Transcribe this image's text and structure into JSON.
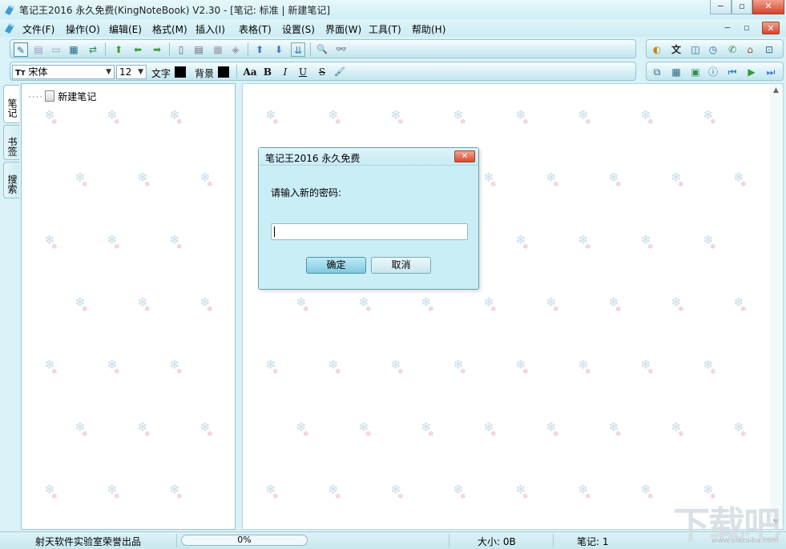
{
  "window": {
    "title": "笔记王2016 永久免费(KingNoteBook) V2.30 - [笔记: 标准 | 新建笔记]",
    "controls": {
      "minimize": "−",
      "restore": "▫",
      "close": "✕"
    }
  },
  "menubar": {
    "items": [
      {
        "label": "文件(F)"
      },
      {
        "label": "操作(O)"
      },
      {
        "label": "编辑(E)"
      },
      {
        "label": "格式(M)"
      },
      {
        "label": "插入(I)"
      },
      {
        "label": "表格(T)"
      },
      {
        "label": "设置(S)"
      },
      {
        "label": "界面(W)"
      },
      {
        "label": "工具(T)"
      },
      {
        "label": "帮助(H)"
      }
    ],
    "mdi_controls": {
      "minimize": "−",
      "restore": "▫",
      "close": "✕"
    }
  },
  "toolbar1": {
    "icons": [
      "✎",
      "▤",
      "▭",
      "▦",
      "⇄",
      "⬆",
      "⬅",
      "➡",
      "▯",
      "▤",
      "▦",
      "◈",
      "⬆",
      "⬇",
      "⇊",
      "🔍",
      "👓"
    ]
  },
  "toolbar_right1": {
    "icons": [
      "◐",
      "文",
      "◫",
      "◷",
      "✆",
      "⌂",
      "⊡"
    ]
  },
  "format_toolbar": {
    "font_name": "宋体",
    "font_size": "12",
    "text_color_label": "文字",
    "bg_color_label": "背景",
    "text_color": "#000000",
    "bg_color": "#000000",
    "aa_label": "Aa",
    "bold_label": "B",
    "italic_label": "I",
    "underline_label": "U",
    "strike_label": "S",
    "brush_icon": "🖌"
  },
  "toolbar_right2": {
    "icons": [
      "⧉",
      "▦",
      "▣",
      "ⓘ",
      "⏮",
      "▶",
      "⏭"
    ]
  },
  "sidetabs": [
    {
      "label": "笔记"
    },
    {
      "label": "书签"
    },
    {
      "label": "搜索"
    }
  ],
  "tree": {
    "items": [
      {
        "label": "新建笔记"
      }
    ]
  },
  "dialog": {
    "title": "笔记王2016 永久免费",
    "prompt": "请输入新的密码:",
    "input_value": "",
    "ok_label": "确定",
    "cancel_label": "取消",
    "close_glyph": "✕"
  },
  "statusbar": {
    "credit": "射天软件实验室荣誉出品",
    "progress": "0%",
    "progress_value": 0,
    "size": "大小: 0B",
    "notes": "笔记: 1"
  },
  "watermark": {
    "text": "下载吧",
    "url": "www.xiazaiba.com"
  },
  "colors": {
    "accent": "#cdeef5",
    "dialog_bg": "#c9eef6",
    "close_red": "#d2452b"
  }
}
